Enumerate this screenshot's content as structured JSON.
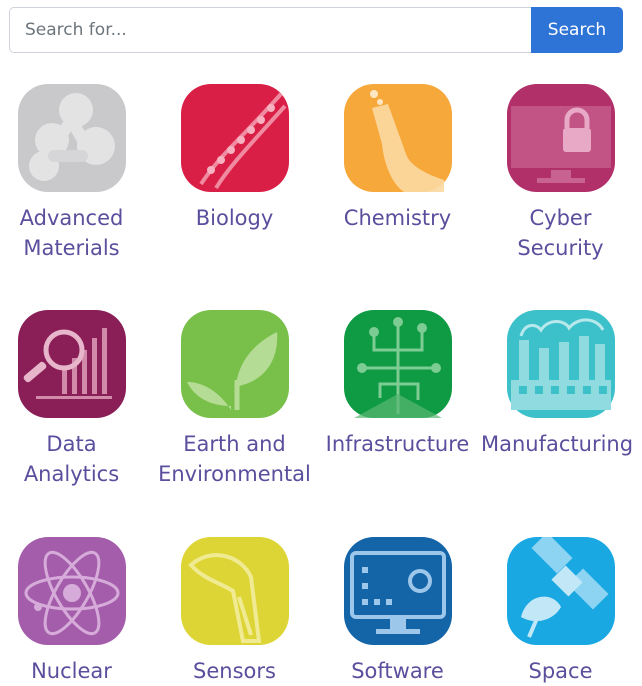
{
  "search": {
    "placeholder": "Search for...",
    "button_label": "Search"
  },
  "categories": [
    {
      "label": "Advanced\nMaterials",
      "icon": "molecule-icon",
      "color": "#c9c9cb"
    },
    {
      "label": "Biology",
      "icon": "dna-icon",
      "color": "#d91f45"
    },
    {
      "label": "Chemistry",
      "icon": "flask-icon",
      "color": "#f7a83b"
    },
    {
      "label": "Cyber\nSecurity",
      "icon": "lock-monitor-icon",
      "color": "#b2306a"
    },
    {
      "label": "Data\nAnalytics",
      "icon": "magnifier-chart-icon",
      "color": "#8a1e57"
    },
    {
      "label": "Earth and\nEnvironmental",
      "icon": "leaf-icon",
      "color": "#79c04a"
    },
    {
      "label": "Infrastructure",
      "icon": "circuit-tree-icon",
      "color": "#0f9a44"
    },
    {
      "label": "Manufacturing",
      "icon": "factory-icon",
      "color": "#3cc1ca"
    },
    {
      "label": "Nuclear",
      "icon": "atom-icon",
      "color": "#a45dab"
    },
    {
      "label": "Sensors",
      "icon": "scanner-icon",
      "color": "#ddd536"
    },
    {
      "label": "Software",
      "icon": "computer-gear-icon",
      "color": "#1464a8"
    },
    {
      "label": "Space",
      "icon": "satellite-icon",
      "color": "#1aa8e3"
    }
  ]
}
